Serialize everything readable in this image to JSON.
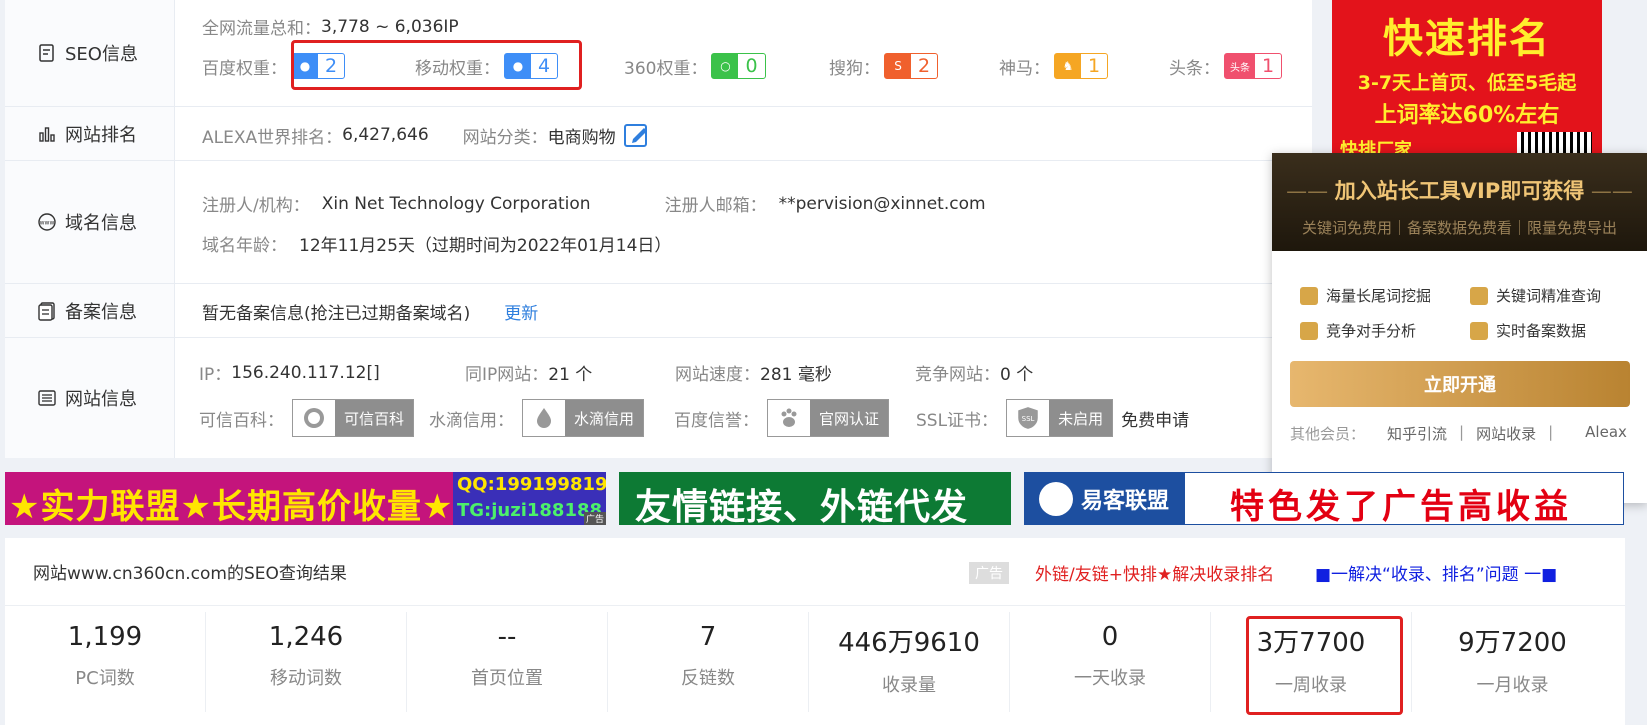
{
  "seo": {
    "label": "SEO信息",
    "traffic_label": "全网流量总和：",
    "traffic_value": "3,778 ~ 6,036IP",
    "weights": [
      {
        "label": "百度权重：",
        "icon": "baidu-paw-icon",
        "value": "2",
        "color": "#3e8ef7"
      },
      {
        "label": "移动权重：",
        "icon": "baidu-paw-icon",
        "value": "4",
        "color": "#3e8ef7"
      },
      {
        "label": "360权重：",
        "icon": "360-icon",
        "value": "0",
        "color": "#3bc24a"
      },
      {
        "label": "搜狗：",
        "icon": "sogou-icon",
        "value": "2",
        "color": "#f0602d"
      },
      {
        "label": "神马：",
        "icon": "shenma-icon",
        "value": "1",
        "color": "#f5a623"
      },
      {
        "label": "头条：",
        "icon": "toutiao-icon",
        "icon_text": "头条",
        "value": "1",
        "color": "#f0506e"
      }
    ]
  },
  "rank": {
    "label": "网站排名",
    "alexa_label": "ALEXA世界排名：",
    "alexa_value": "6,427,646",
    "category_label": "网站分类：",
    "category_value": "电商购物"
  },
  "domain": {
    "label": "域名信息",
    "registrant_label": "注册人/机构：",
    "registrant_value": "Xin Net Technology Corporation",
    "email_label": "注册人邮箱：",
    "email_value": "**pervision@xinnet.com",
    "age_label": "域名年龄：",
    "age_value": "12年11月25天（过期时间为2022年01月14日）"
  },
  "icp": {
    "label": "备案信息",
    "text": "暂无备案信息(抢注已过期备案域名)",
    "update": "更新"
  },
  "site": {
    "label": "网站信息",
    "ip_label": "IP：",
    "ip_value": "156.240.117.12[]",
    "sameip_label": "同IP网站：",
    "sameip_value": "21 个",
    "speed_label": "网站速度：",
    "speed_value": "281 毫秒",
    "compete_label": "竞争网站：",
    "compete_value": "0 个",
    "kexin_label": "可信百科：",
    "kexin_badge": "可信百科",
    "shuidi_label": "水滴信用：",
    "shuidi_badge": "水滴信用",
    "baidu_label": "百度信誉：",
    "baidu_badge": "官网认证",
    "ssl_label": "SSL证书：",
    "ssl_badge": "未启用",
    "ssl_icon_text": "SSL",
    "ssl_apply": "免费申请"
  },
  "ad_right": {
    "title": "快速排名",
    "line2": "3-7天上首页、低至5毛起",
    "line3": "上词率达60%左右",
    "line4": "快排厂家"
  },
  "vip": {
    "title": "加入站长工具VIP即可获得",
    "subtitle": "关键词免费用｜备案数据免费看｜限量免费导出",
    "features": [
      "海量长尾词挖掘",
      "关键词精准查询",
      "竞争对手分析",
      "实时备案数据"
    ],
    "button": "立即开通",
    "other_label": "其他会员：",
    "other_items": [
      "知乎引流",
      "网站收录",
      "Aleax"
    ]
  },
  "banners": {
    "b1_text": "★实力联盟★长期高价收量★",
    "b1_qq": "QQ:199199819",
    "b1_tg": "TG:juzi188188",
    "b1_ad": "广告",
    "b2_text": "友情链接、外链代发",
    "b3_logo": "易客联盟",
    "b3_text": "特色发了广告高收益"
  },
  "result": {
    "title": "网站www.cn360cn.com的SEO查询结果",
    "ad_tag": "广告",
    "link1": "外链/友链+快排★解决收录排名",
    "link2": "■一解决“收录、排名”问题 一■",
    "stats": [
      {
        "value": "1,199",
        "label": "PC词数"
      },
      {
        "value": "1,246",
        "label": "移动词数"
      },
      {
        "value": "--",
        "label": "首页位置"
      },
      {
        "value": "7",
        "label": "反链数"
      },
      {
        "value": "446万9610",
        "label": "收录量"
      },
      {
        "value": "0",
        "label": "一天收录"
      },
      {
        "value": "3万7700",
        "label": "一周收录"
      },
      {
        "value": "9万7200",
        "label": "一月收录"
      }
    ]
  },
  "colors": {
    "highlight_red": "#e02020",
    "link_blue": "#2f7fde",
    "vip_gold": "#d7a648"
  }
}
